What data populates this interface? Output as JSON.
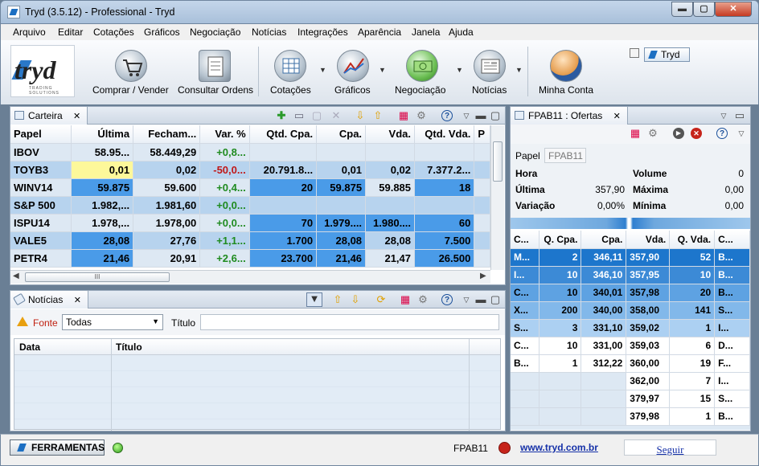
{
  "window": {
    "title": "Tryd (3.5.12) - Professional - Tryd",
    "min": "▬",
    "max": "▢",
    "close": "✕"
  },
  "menu": [
    "Arquivo",
    "Editar",
    "Cotações",
    "Gráficos",
    "Negociação",
    "Notícias",
    "Integrações",
    "Aparência",
    "Janela",
    "Ajuda"
  ],
  "brand": {
    "logo_text": "tryd",
    "tagline": "TRADING SOLUTIONS"
  },
  "toolbar": {
    "comprar": "Comprar / Vender",
    "consultar": "Consultar Ordens",
    "cotacoes": "Cotações",
    "graficos": "Gráficos",
    "negociacao": "Negociação",
    "noticias": "Notícias",
    "minha_conta": "Minha Conta"
  },
  "perspective": {
    "label": "Tryd"
  },
  "carteira": {
    "tab": "Carteira",
    "columns": [
      "Papel",
      "Última",
      "Fecham...",
      "Var. %",
      "Qtd. Cpa.",
      "Cpa.",
      "Vda.",
      "Qtd. Vda.",
      "P"
    ],
    "rows": [
      [
        "IBOV",
        "58.95...",
        "58.449,29",
        "+0,8...",
        "",
        "",
        "",
        "",
        ""
      ],
      [
        "TOYB3",
        "0,01",
        "0,02",
        "-50,0...",
        "20.791.8...",
        "0,01",
        "0,02",
        "7.377.2...",
        ""
      ],
      [
        "WINV14",
        "59.875",
        "59.600",
        "+0,4...",
        "20",
        "59.875",
        "59.885",
        "18",
        ""
      ],
      [
        "S&P 500",
        "1.982,...",
        "1.981,60",
        "+0,0...",
        "",
        "",
        "",
        "",
        ""
      ],
      [
        "ISPU14",
        "1.978,...",
        "1.978,00",
        "+0,0...",
        "70",
        "1.979....",
        "1.980....",
        "60",
        ""
      ],
      [
        "VALE5",
        "28,08",
        "27,76",
        "+1,1...",
        "1.700",
        "28,08",
        "28,08",
        "7.500",
        ""
      ],
      [
        "PETR4",
        "21,46",
        "20,91",
        "+2,6...",
        "23.700",
        "21,46",
        "21,47",
        "26.500",
        ""
      ]
    ],
    "hscroll_grip": "III"
  },
  "noticias": {
    "tab": "Notícias",
    "fonte_label": "Fonte",
    "fonte_value": "Todas",
    "titulo_label": "Título",
    "titulo_value": "",
    "columns": [
      "Data",
      "Título"
    ]
  },
  "ofertas": {
    "tab": "FPAB11 : Ofertas",
    "papel_label": "Papel",
    "papel_value": "FPAB11",
    "info": [
      {
        "label": "Hora",
        "value": "",
        "label2": "Volume",
        "value2": "0"
      },
      {
        "label": "Última",
        "value": "357,90",
        "label2": "Máxima",
        "value2": "0,00"
      },
      {
        "label": "Variação",
        "value": "0,00%",
        "label2": "Mínima",
        "value2": "0,00"
      }
    ],
    "columns": [
      "C...",
      "Q. Cpa.",
      "Cpa.",
      "Vda.",
      "Q. Vda.",
      "C..."
    ],
    "book": [
      [
        "M...",
        "2",
        "346,11",
        "357,90",
        "52",
        "B..."
      ],
      [
        "I...",
        "10",
        "346,10",
        "357,95",
        "10",
        "B..."
      ],
      [
        "C...",
        "10",
        "340,01",
        "357,98",
        "20",
        "B..."
      ],
      [
        "X...",
        "200",
        "340,00",
        "358,00",
        "141",
        "S..."
      ],
      [
        "S...",
        "3",
        "331,10",
        "359,02",
        "1",
        "I..."
      ],
      [
        "C...",
        "10",
        "331,00",
        "359,03",
        "6",
        "D..."
      ],
      [
        "B...",
        "1",
        "312,22",
        "360,00",
        "19",
        "F..."
      ],
      [
        "",
        "",
        "",
        "362,00",
        "7",
        "I..."
      ],
      [
        "",
        "",
        "",
        "379,97",
        "15",
        "S..."
      ],
      [
        "",
        "",
        "",
        "379,98",
        "1",
        "B..."
      ]
    ]
  },
  "status": {
    "ferramentas": "FERRAMENTAS",
    "symbol": "FPAB11",
    "link": "www.tryd.com.br",
    "seguir": "Seguir"
  },
  "colors": {
    "row_light": "#dde8f3",
    "row_mid": "#b7d3ee",
    "row_dark": "#4a9be8",
    "positive": "#1f8b1f",
    "negative": "#c01818"
  }
}
